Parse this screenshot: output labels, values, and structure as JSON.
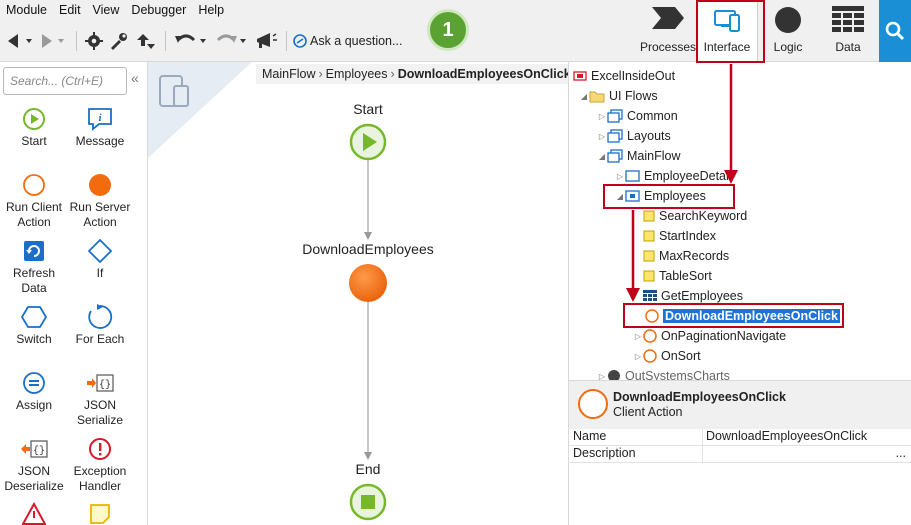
{
  "menu": [
    "Module",
    "Edit",
    "View",
    "Debugger",
    "Help"
  ],
  "toolbar": {
    "ask_label": "Ask a question..."
  },
  "step_badge": "1",
  "tabs": [
    {
      "label": "Processes",
      "icon": "processes-icon"
    },
    {
      "label": "Interface",
      "icon": "interface-icon",
      "active": true
    },
    {
      "label": "Logic",
      "icon": "logic-icon"
    },
    {
      "label": "Data",
      "icon": "data-icon"
    }
  ],
  "toolbox": {
    "search_placeholder": "Search... (Ctrl+E)",
    "collapse_glyph": "«",
    "tools": [
      {
        "label": "Start",
        "icon": "start-icon"
      },
      {
        "label": "Message",
        "icon": "message-icon"
      },
      {
        "label": "Run Client Action",
        "icon": "run-client-action-icon"
      },
      {
        "label": "Run Server Action",
        "icon": "run-server-action-icon"
      },
      {
        "label": "Refresh Data",
        "icon": "refresh-data-icon"
      },
      {
        "label": "If",
        "icon": "if-icon"
      },
      {
        "label": "Switch",
        "icon": "switch-icon"
      },
      {
        "label": "For Each",
        "icon": "for-each-icon"
      },
      {
        "label": "Assign",
        "icon": "assign-icon"
      },
      {
        "label": "JSON Serialize",
        "icon": "json-serialize-icon"
      },
      {
        "label": "JSON Deserialize",
        "icon": "json-deserialize-icon"
      },
      {
        "label": "Exception Handler",
        "icon": "exception-handler-icon"
      }
    ]
  },
  "breadcrumb": {
    "items": [
      "MainFlow",
      "Employees"
    ],
    "separator": "›",
    "current": "DownloadEmployeesOnClick"
  },
  "flow": {
    "start": "Start",
    "action": "DownloadEmployees",
    "end": "End"
  },
  "tree": {
    "root": "ExcelInsideOut",
    "ui_flows": "UI Flows",
    "common": "Common",
    "layouts": "Layouts",
    "mainflow": "MainFlow",
    "employee_detail": "EmployeeDetail",
    "employees": "Employees",
    "search_keyword": "SearchKeyword",
    "start_index": "StartIndex",
    "max_records": "MaxRecords",
    "table_sort": "TableSort",
    "get_employees": "GetEmployees",
    "download_action": "DownloadEmployeesOnClick",
    "on_pagination": "OnPaginationNavigate",
    "on_sort": "OnSort",
    "outsystems_charts": "OutSystemsCharts"
  },
  "properties": {
    "title": "DownloadEmployeesOnClick",
    "subtitle": "Client Action",
    "rows": [
      {
        "key": "Name",
        "value": "DownloadEmployeesOnClick"
      },
      {
        "key": "Description",
        "value": "",
        "more": "..."
      }
    ]
  },
  "colors": {
    "accent": "#1b8fd6",
    "highlight": "#c0001a",
    "node_orange": "#f26b0f",
    "node_green": "#76b82a",
    "badge_green": "#5aa332"
  }
}
